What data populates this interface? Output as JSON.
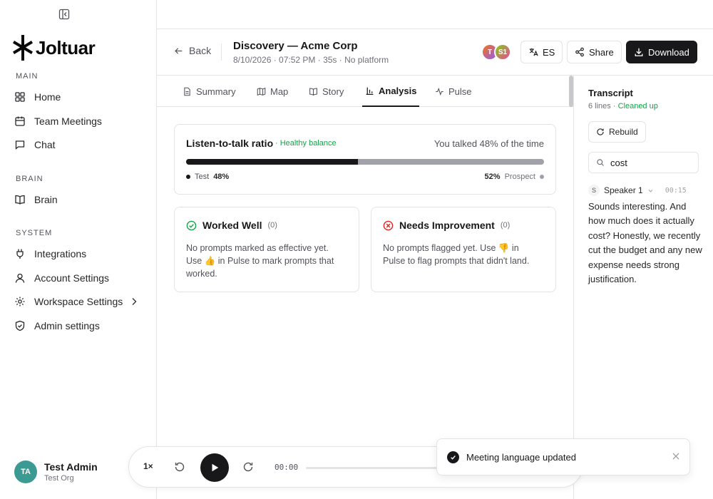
{
  "app": {
    "logo_text": "Joltuar"
  },
  "sidebar": {
    "sections": [
      {
        "label": "MAIN"
      },
      {
        "label": "BRAIN"
      },
      {
        "label": "SYSTEM"
      }
    ],
    "items": [
      {
        "label": "Home",
        "icon": "layout-grid-icon"
      },
      {
        "label": "Team Meetings",
        "icon": "calendar-icon"
      },
      {
        "label": "Chat",
        "icon": "message-square-icon"
      },
      {
        "label": "Brain",
        "icon": "book-open-icon"
      },
      {
        "label": "Integrations",
        "icon": "plug-icon"
      },
      {
        "label": "Account Settings",
        "icon": "user-icon"
      },
      {
        "label": "Workspace Settings",
        "icon": "gear-icon"
      },
      {
        "label": "Admin settings",
        "icon": "shield-check-icon"
      }
    ],
    "user": {
      "initials": "TA",
      "name": "Test Admin",
      "org": "Test Org"
    }
  },
  "header": {
    "back_label": "Back",
    "title": "Discovery — Acme Corp",
    "subtitle": "8/10/2026 · 07:52 PM · 35s · No platform",
    "participants": [
      "T",
      "S1"
    ],
    "language_label": "ES",
    "share_label": "Share",
    "download_label": "Download"
  },
  "tabs": [
    {
      "label": "Summary",
      "icon": "file-text-icon",
      "active": false
    },
    {
      "label": "Map",
      "icon": "map-icon",
      "active": false
    },
    {
      "label": "Story",
      "icon": "book-icon",
      "active": false
    },
    {
      "label": "Analysis",
      "icon": "bar-chart-icon",
      "active": true
    },
    {
      "label": "Pulse",
      "icon": "activity-icon",
      "active": false
    }
  ],
  "analysis": {
    "ratio": {
      "title": "Listen-to-talk ratio",
      "badge": "· Healthy balance",
      "summary": "You talked 48% of the time",
      "self_label": "Test",
      "self_pct": "48%",
      "self_fraction": 0.48,
      "other_label": "Prospect",
      "other_pct": "52%"
    },
    "worked_well": {
      "title": "Worked Well",
      "count": "(0)",
      "text": "No prompts marked as effective yet. Use 👍 in Pulse to mark prompts that worked."
    },
    "needs_improvement": {
      "title": "Needs Improvement",
      "count": "(0)",
      "text": "No prompts flagged yet. Use 👎 in Pulse to flag prompts that didn't land."
    }
  },
  "player": {
    "speed": "1×",
    "time": "00:00"
  },
  "transcript": {
    "title": "Transcript",
    "lines": "6 lines",
    "status": "· Cleaned up",
    "rebuild_label": "Rebuild",
    "search_value": "cost",
    "entry": {
      "avatar": "S",
      "speaker": "Speaker 1",
      "time": "00:15",
      "text": "Sounds interesting. And how much does it actually cost? Honestly, we recently cut the budget and any new expense needs strong justification."
    }
  },
  "toast": {
    "message": "Meeting language updated"
  },
  "colors": {
    "accent": "#18181b",
    "positive": "#16a34a",
    "negative": "#dc2626",
    "avatar_bg": "#3b9a92"
  }
}
